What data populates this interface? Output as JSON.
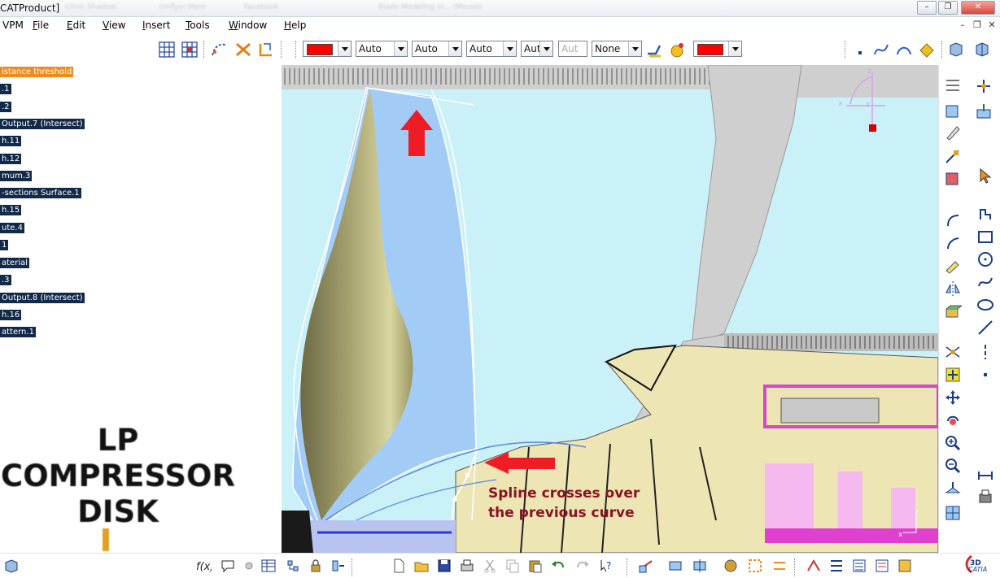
{
  "window": {
    "title": "CATProduct]",
    "ghost_tabs": [
      "Clinic Shadow",
      "Unifyer Here",
      "Facebook",
      "Blade Modeling in... (Messe)"
    ],
    "minimize": "–",
    "restore": "❐",
    "close": "✕"
  },
  "menu": {
    "items": [
      "VPM",
      "File",
      "Edit",
      "View",
      "Insert",
      "Tools",
      "Window",
      "Help"
    ],
    "mdi": [
      "–",
      "❐",
      "✕"
    ]
  },
  "graphic_properties": {
    "fill_color": "#ff0000",
    "transparency": "Auto",
    "line_thickness": "Auto",
    "line_type": "Auto",
    "point_symbol": "Aut",
    "rendering_style": "Aut",
    "layer": "None",
    "color2": "#ff0000"
  },
  "spec_tree": {
    "items": [
      {
        "label": "istance threshold",
        "active": true
      },
      {
        "label": ".1"
      },
      {
        "label": ".2"
      },
      {
        "label": "Output.7 (Intersect)"
      },
      {
        "label": "h.11"
      },
      {
        "label": "h.12"
      },
      {
        "label": "mum.3"
      },
      {
        "label": "-sections Surface.1"
      },
      {
        "label": "h.15"
      },
      {
        "label": "ute.4"
      },
      {
        "label": "1"
      },
      {
        "label": "aterial"
      },
      {
        "label": ".3"
      },
      {
        "label": "Output.8 (Intersect)"
      },
      {
        "label": "h.16"
      },
      {
        "label": "attern.1"
      }
    ]
  },
  "viewport": {
    "disk_label": [
      "LP",
      "COMPRESSOR",
      "DISK"
    ],
    "annotation": [
      "Spline crosses over",
      "the previous curve"
    ],
    "compass_axes": [
      "z",
      "x",
      "y"
    ],
    "mini_axes": [
      "z",
      "x"
    ]
  },
  "branding": {
    "logo_text": "CATIA"
  }
}
